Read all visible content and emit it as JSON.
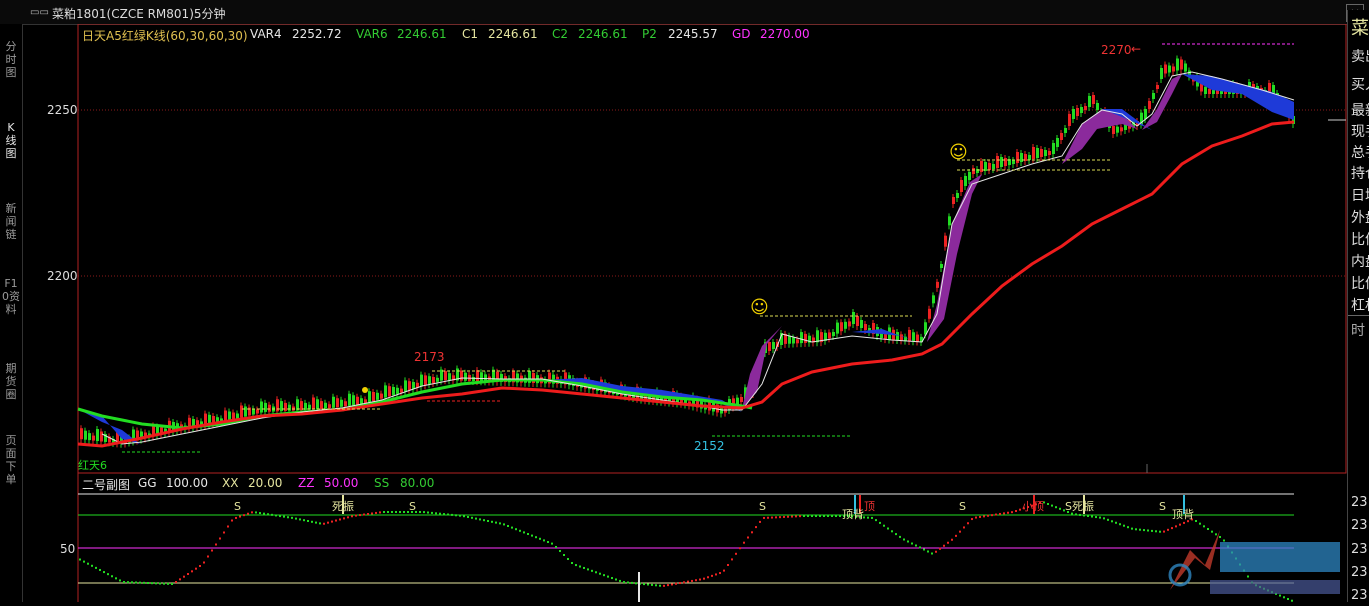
{
  "window": {
    "icon": "▭▭",
    "title": "菜粕1801(CZCE RM801)5分钟",
    "close": "×"
  },
  "left_tabs": [
    {
      "label": "分时图",
      "active": false
    },
    {
      "label": "K线图",
      "active": true
    },
    {
      "label": "新闻链",
      "active": false
    },
    {
      "label": "F10资料",
      "active": false
    },
    {
      "label": "期货圈",
      "active": false
    },
    {
      "label": "页面下单",
      "active": false
    }
  ],
  "main_chart": {
    "legend": [
      {
        "label": "日天A5红绿K线(60,30,60,30)",
        "color": "#e0c050"
      },
      {
        "label": "VAR4",
        "color": "#e6e6e6"
      },
      {
        "label": "2252.72",
        "color": "#e6e6e6"
      },
      {
        "label": "VAR6",
        "color": "#33cc33"
      },
      {
        "label": "2246.61",
        "color": "#33cc33"
      },
      {
        "label": "C1",
        "color": "#e6e6a0"
      },
      {
        "label": "2246.61",
        "color": "#e6e6a0"
      },
      {
        "label": "C2",
        "color": "#33cc33"
      },
      {
        "label": "2246.61",
        "color": "#33cc33"
      },
      {
        "label": "P2",
        "color": "#33cc33"
      },
      {
        "label": "2245.57",
        "color": "#e6e6e6"
      },
      {
        "label": "GD",
        "color": "#ff33ff"
      },
      {
        "label": "2270.00",
        "color": "#ff33ff"
      }
    ],
    "y_ticks": [
      "2250",
      "2200"
    ],
    "annotations": {
      "high_a": "2173",
      "low": "2152",
      "high_b": "2270",
      "arrow_left": "←",
      "bottom_left": "红天6"
    },
    "face_icon": "☺"
  },
  "sub_chart": {
    "legend": [
      {
        "label": "二号副图",
        "color": "#e6e6e6"
      },
      {
        "label": "GG",
        "color": "#e6e6e6"
      },
      {
        "label": "100.00",
        "color": "#e6e6e6"
      },
      {
        "label": "XX",
        "color": "#e6e6a0"
      },
      {
        "label": "20.00",
        "color": "#e6e6a0"
      },
      {
        "label": "ZZ",
        "color": "#ff33ff"
      },
      {
        "label": "50.00",
        "color": "#ff33ff"
      },
      {
        "label": "SS",
        "color": "#33cc33"
      },
      {
        "label": "80.00",
        "color": "#33cc33"
      }
    ],
    "y_tick": "50",
    "s_marker": "S",
    "signals": [
      "死振",
      "顶背",
      "顶",
      "小顶",
      "顶背",
      "S死振"
    ]
  },
  "right_panel": {
    "title": "菜",
    "rows": [
      "卖出",
      "买入",
      "最新",
      "现手",
      "总手",
      "持仓",
      "日增",
      "外盘",
      "比值",
      "内盘",
      "比值",
      "杠杆"
    ],
    "footer": "时",
    "axis_values": [
      "23",
      "23",
      "23",
      "23",
      "23"
    ]
  }
}
